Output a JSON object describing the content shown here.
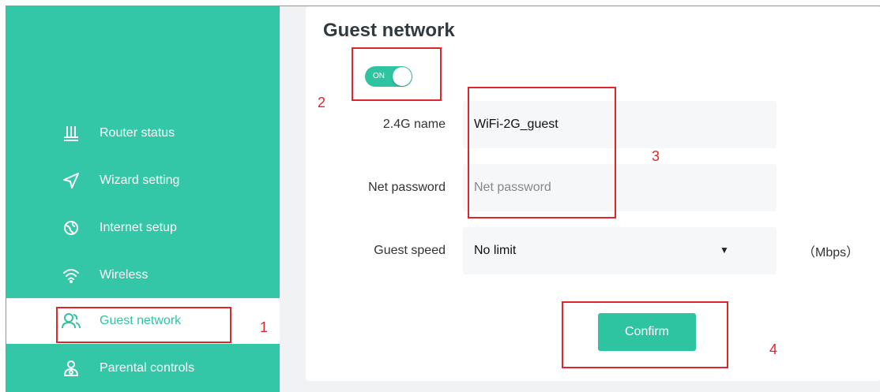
{
  "page_title": "Guest network",
  "sidebar": {
    "items": [
      {
        "label": "Router status",
        "icon": "router-icon",
        "active": false
      },
      {
        "label": "Wizard setting",
        "icon": "send-icon",
        "active": false
      },
      {
        "label": "Internet setup",
        "icon": "globe-icon",
        "active": false
      },
      {
        "label": "Wireless",
        "icon": "wifi-icon",
        "active": false
      },
      {
        "label": "Guest network",
        "icon": "users-icon",
        "active": true
      },
      {
        "label": "Parental controls",
        "icon": "parent-icon",
        "active": false
      }
    ]
  },
  "toggle": {
    "state": "ON"
  },
  "form": {
    "name_label": "2.4G name",
    "name_value": "WiFi-2G_guest",
    "password_label": "Net password",
    "password_placeholder": "Net password",
    "speed_label": "Guest speed",
    "speed_value": "No limit",
    "speed_units": "（Mbps）",
    "caret": "▼"
  },
  "confirm_label": "Confirm",
  "annotations": [
    "1",
    "2",
    "3",
    "4"
  ],
  "colors": {
    "accent": "#2ec4a1",
    "sidebar_bg": "#33c6a7",
    "annotation": "#e0262c"
  }
}
